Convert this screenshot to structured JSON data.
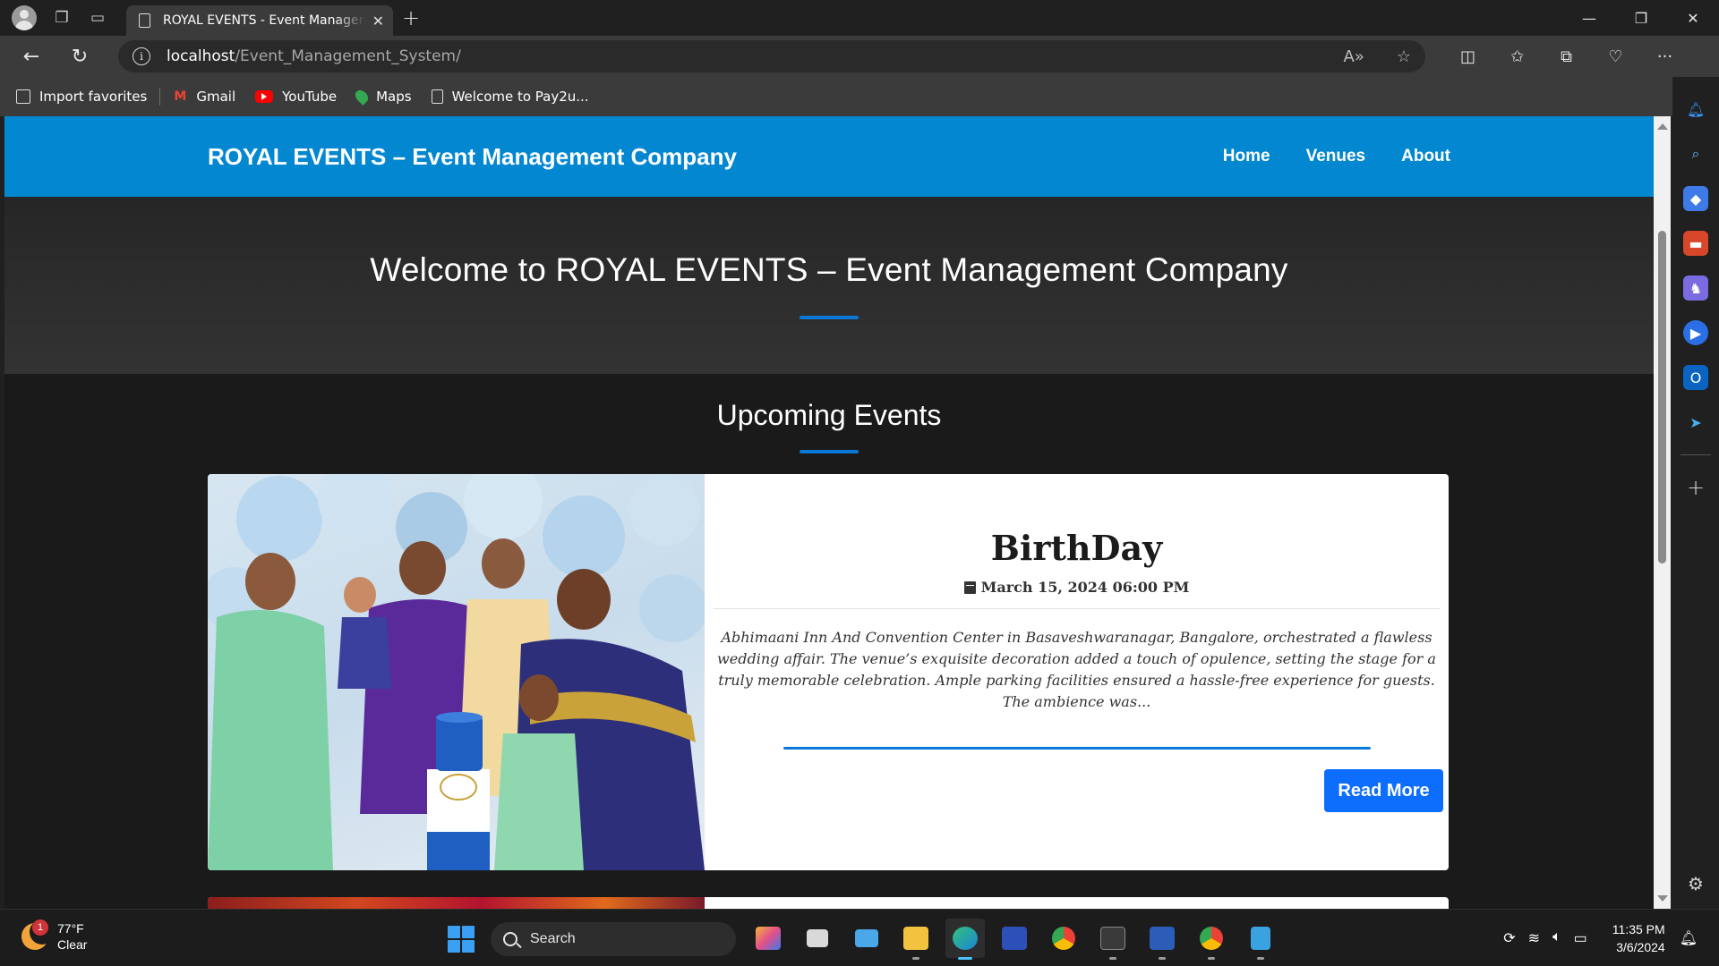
{
  "browser": {
    "tab_title": "ROYAL EVENTS - Event Management Company",
    "url_host": "localhost",
    "url_path": "/Event_Management_System/",
    "bookmarks": [
      "Import favorites",
      "Gmail",
      "YouTube",
      "Maps",
      "Welcome to Pay2u..."
    ]
  },
  "site": {
    "brand": "ROYAL EVENTS – Event Management Company",
    "nav": [
      "Home",
      "Venues",
      "About"
    ],
    "hero_title": "Welcome to ROYAL EVENTS – Event Management Company",
    "section_title": "Upcoming Events"
  },
  "event": {
    "title": "BirthDay",
    "date": "March 15, 2024 06:00 PM",
    "description": "Abhimaani Inn And Convention Center in Basaveshwaranagar, Bangalore, orchestrated a flawless wedding affair. The venue’s exquisite decoration added a touch of opulence, setting the stage for a truly memorable celebration. Ample parking facilities ensured a hassle-free experience for guests. The ambience was...",
    "button": "Read More"
  },
  "taskbar": {
    "weather_badge": "1",
    "temperature": "77°F",
    "condition": "Clear",
    "search_label": "Search",
    "time": "11:35 PM",
    "date": "3/6/2024"
  },
  "colors": {
    "nav_blue": "#0287d0",
    "accent": "#0a78d8",
    "button": "#0d6efd"
  }
}
